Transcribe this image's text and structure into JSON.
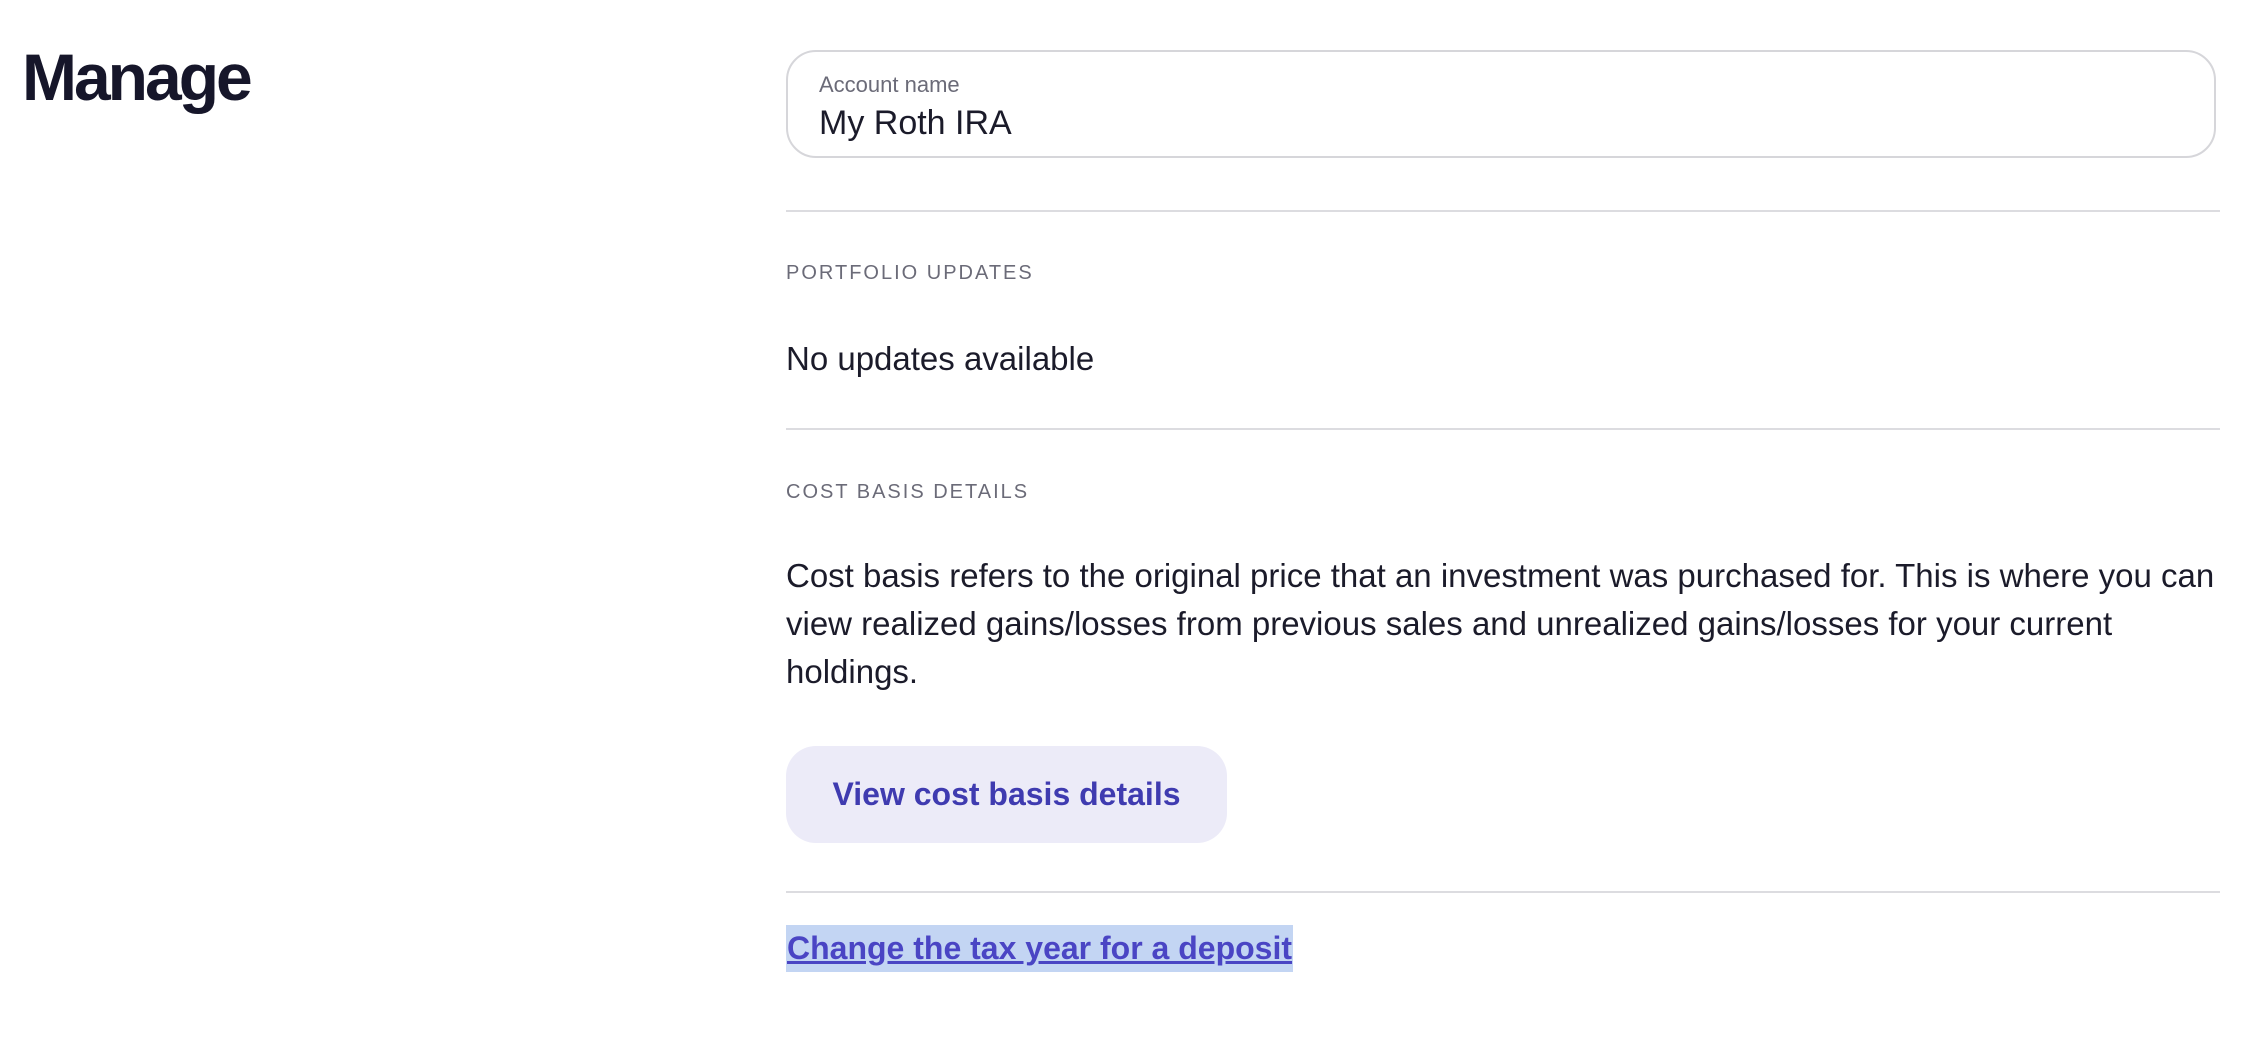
{
  "page": {
    "title": "Manage"
  },
  "account": {
    "name_label": "Account name",
    "name_value": "My Roth IRA"
  },
  "portfolio_updates": {
    "heading": "PORTFOLIO UPDATES",
    "message": "No updates available"
  },
  "cost_basis": {
    "heading": "COST BASIS DETAILS",
    "description": "Cost basis refers to the original price that an investment was purchased for. This is where you can view realized gains/losses from previous sales and unrealized gains/losses for your current holdings.",
    "button_label": "View cost basis details"
  },
  "tax_year_link": {
    "label": "Change the tax year for a deposit"
  },
  "colors": {
    "accent": "#3f3bb0",
    "button_bg": "#ecebf8",
    "selection_highlight": "#c3d5f3"
  }
}
